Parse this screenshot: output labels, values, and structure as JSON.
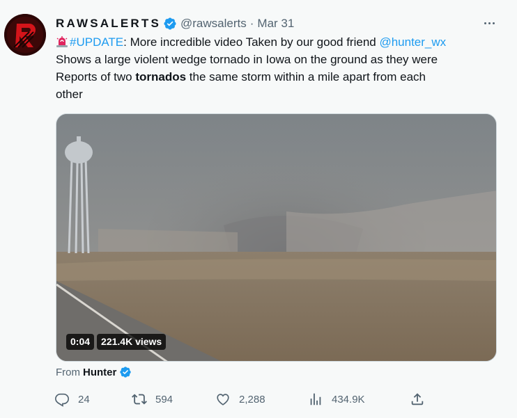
{
  "tweet": {
    "display_name": "RAWSALERTS",
    "handle": "@rawsalerts",
    "separator": "·",
    "date": "Mar 31",
    "text": {
      "line1_hashtag": "#UPDATE",
      "line1_text": ": More incredible video Taken by our good friend ",
      "line1_mention": "@hunter_wx",
      "line2": "Shows a large violent wedge tornado in Iowa on the ground as they were",
      "line3_before": "Reports of two ",
      "line3_bold": "tornados",
      "line3_after": " the same storm within a mile apart from each",
      "line4": "other"
    },
    "media": {
      "duration": "0:04",
      "views": "221.4K views"
    },
    "attribution": {
      "prefix": "From",
      "name": "Hunter"
    },
    "actions": {
      "replies": "24",
      "retweets": "594",
      "likes": "2,288",
      "views": "434.9K"
    }
  },
  "colors": {
    "accent": "#1d9bf0",
    "secondary_text": "#536471",
    "siren": "#e0245e"
  },
  "icons": [
    "verified-badge-icon",
    "more-icon",
    "siren-emoji-icon",
    "reply-icon",
    "retweet-icon",
    "like-icon",
    "views-icon",
    "share-icon"
  ]
}
